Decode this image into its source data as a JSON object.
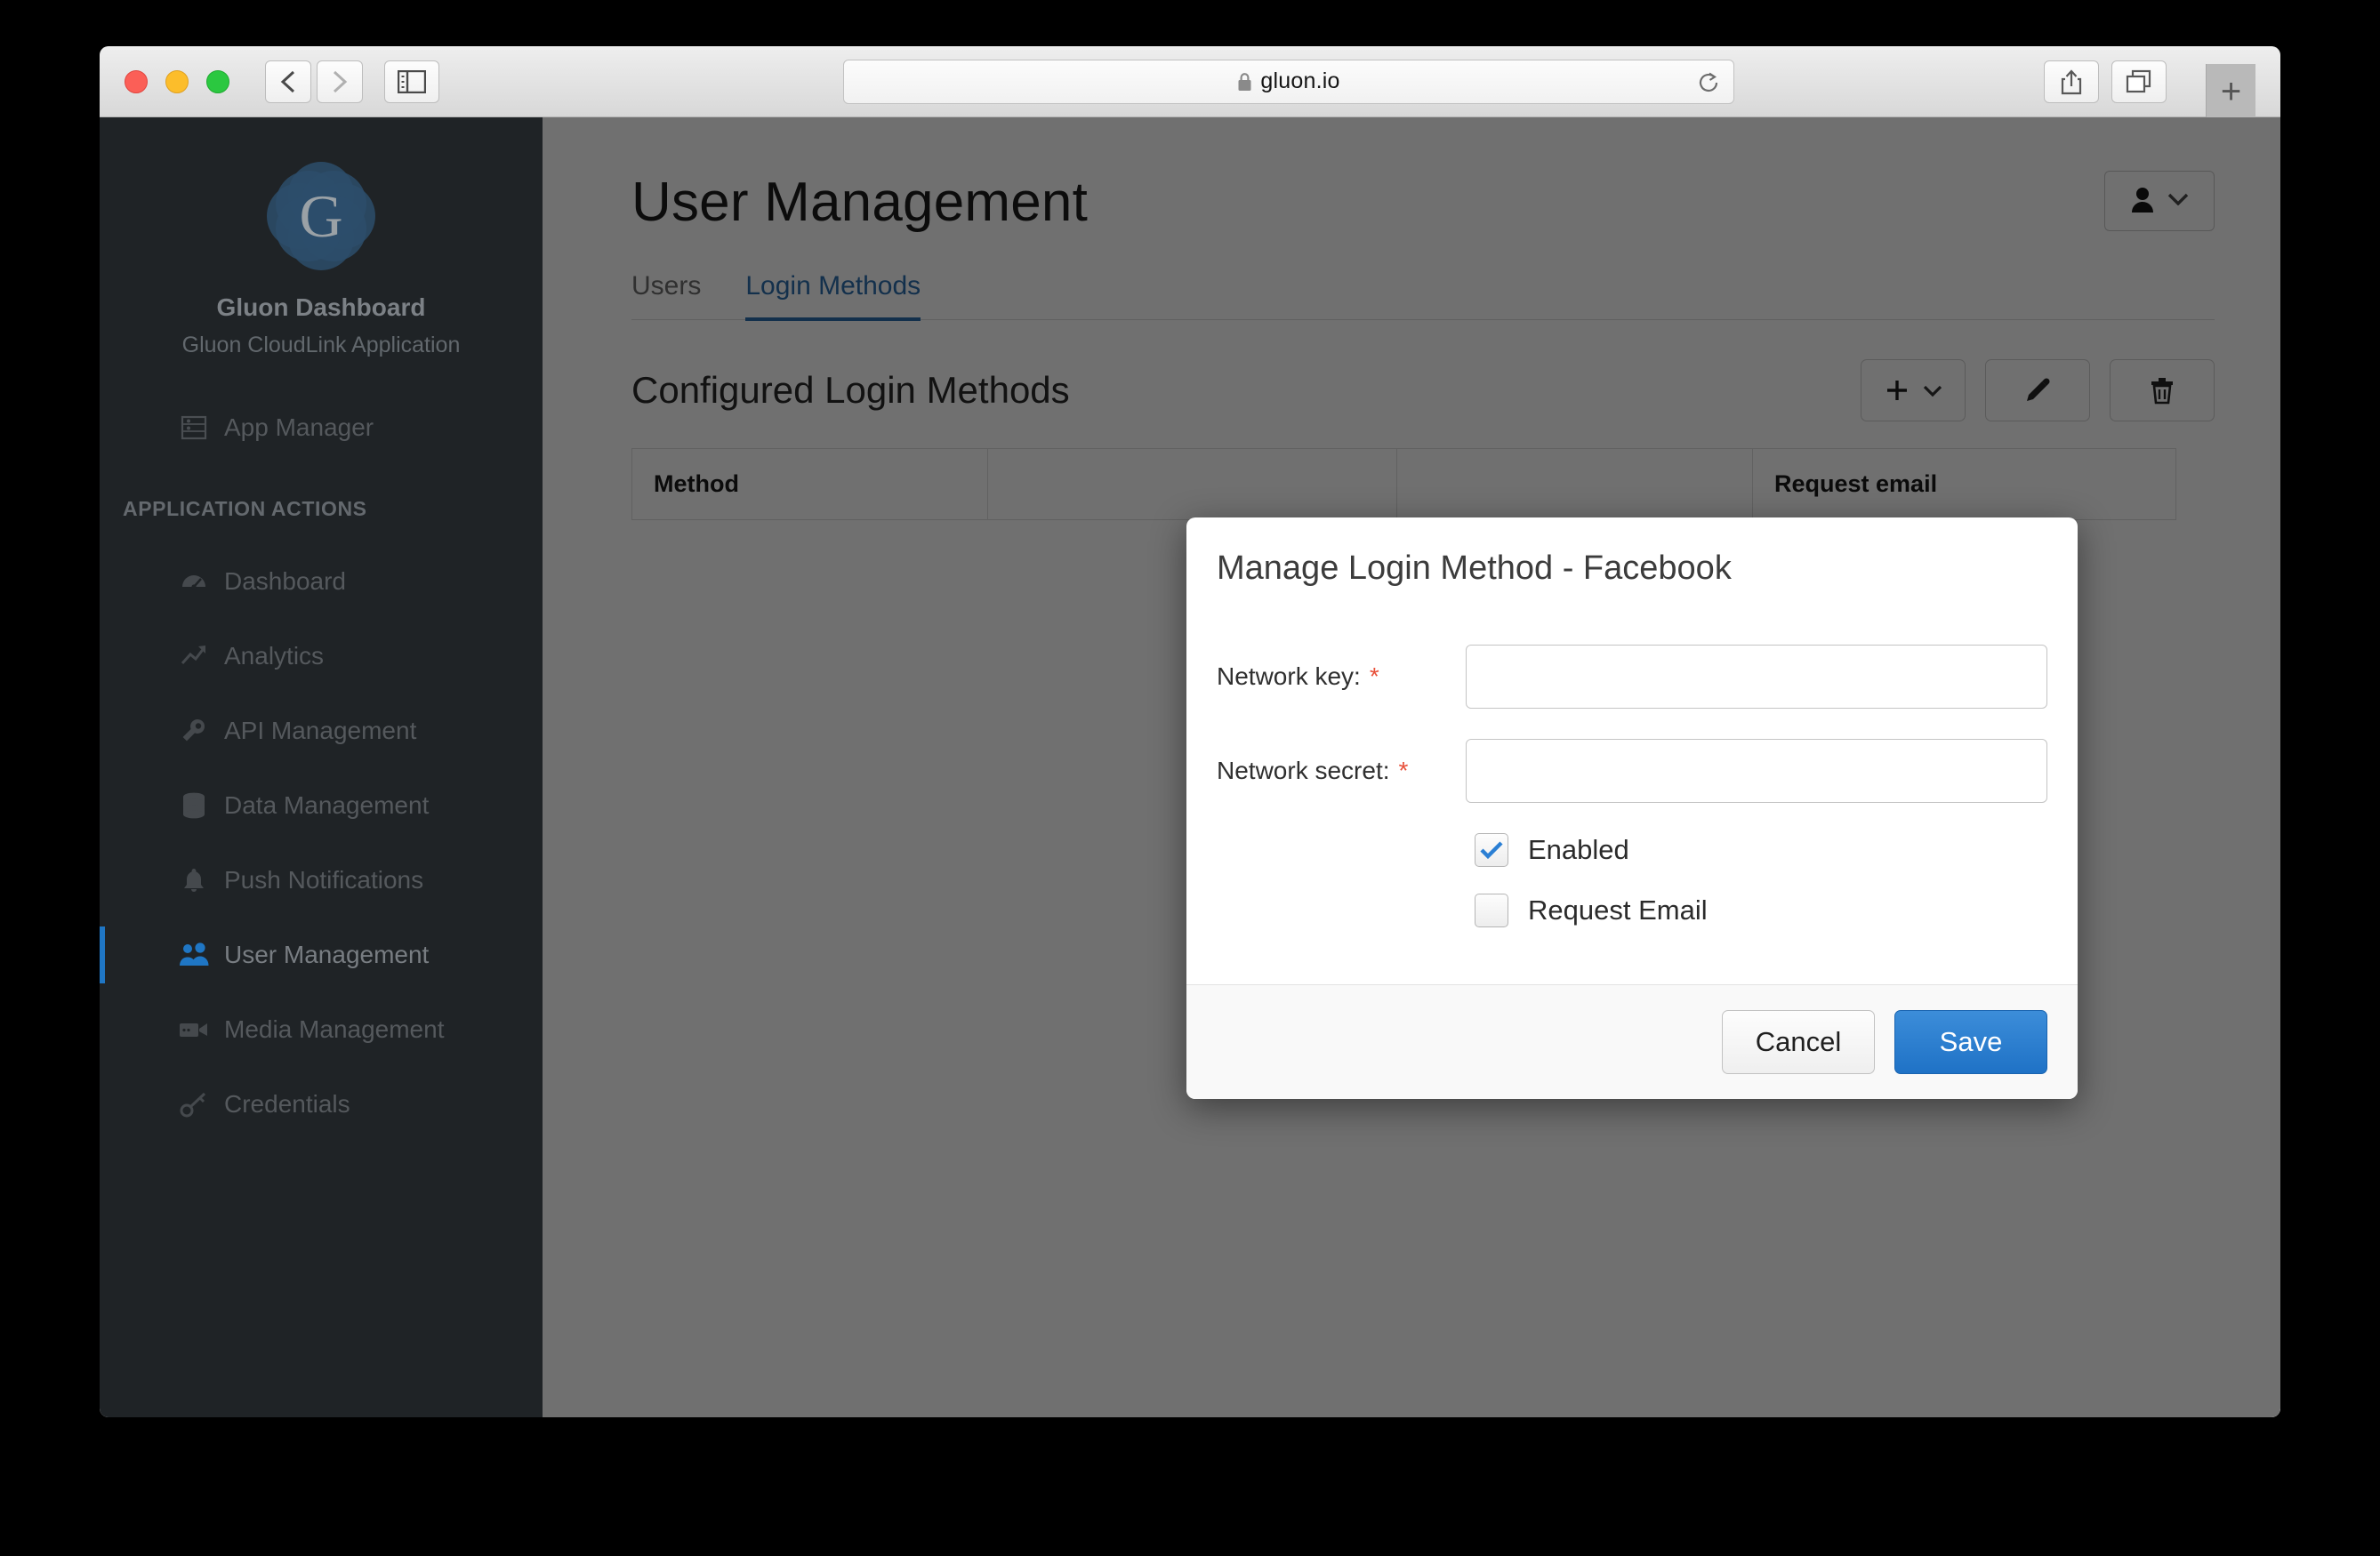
{
  "browser": {
    "url": "gluon.io",
    "lock_icon": "lock-icon",
    "back_icon": "chevron-left-icon",
    "forward_icon": "chevron-right-icon",
    "sidebar_icon": "sidebar-toggle-icon",
    "reload_icon": "reload-icon",
    "share_icon": "share-icon",
    "tabs_icon": "tab-overview-icon",
    "new_tab_label": "+"
  },
  "sidebar": {
    "logo_letter": "G",
    "title": "Gluon Dashboard",
    "subtitle": "Gluon CloudLink Application",
    "top_item": {
      "label": "App Manager",
      "icon": "server-list-icon"
    },
    "section_label": "APPLICATION ACTIONS",
    "items": [
      {
        "label": "Dashboard",
        "icon": "gauge-icon",
        "active": false
      },
      {
        "label": "Analytics",
        "icon": "trend-up-icon",
        "active": false
      },
      {
        "label": "API Management",
        "icon": "wrench-icon",
        "active": false
      },
      {
        "label": "Data Management",
        "icon": "database-icon",
        "active": false
      },
      {
        "label": "Push Notifications",
        "icon": "bell-icon",
        "active": false
      },
      {
        "label": "User Management",
        "icon": "users-icon",
        "active": true
      },
      {
        "label": "Media Management",
        "icon": "video-camera-icon",
        "active": false
      },
      {
        "label": "Credentials",
        "icon": "key-icon",
        "active": false
      }
    ]
  },
  "main": {
    "page_title": "User Management",
    "account_icon": "user-icon",
    "account_chevron_icon": "chevron-down-icon",
    "tabs": [
      {
        "label": "Users",
        "active": false
      },
      {
        "label": "Login Methods",
        "active": true
      }
    ],
    "section_title": "Configured Login Methods",
    "actions": [
      {
        "name": "add-login-method-button",
        "icon": "plus-icon",
        "has_chevron": true
      },
      {
        "name": "edit-login-method-button",
        "icon": "pencil-icon",
        "has_chevron": false
      },
      {
        "name": "delete-login-method-button",
        "icon": "trash-icon",
        "has_chevron": false
      }
    ],
    "table": {
      "columns": [
        "Method",
        "",
        "",
        "Request email"
      ],
      "rows": []
    }
  },
  "modal": {
    "title": "Manage Login Method - Facebook",
    "fields": [
      {
        "label": "Network key:",
        "required": "*",
        "value": "",
        "placeholder": ""
      },
      {
        "label": "Network secret:",
        "required": "*",
        "value": "",
        "placeholder": ""
      }
    ],
    "checkboxes": [
      {
        "label": "Enabled",
        "checked": true
      },
      {
        "label": "Request Email",
        "checked": false
      }
    ],
    "cancel_label": "Cancel",
    "save_label": "Save"
  },
  "colors": {
    "accent_blue": "#1f76c4",
    "save_blue": "#2b7fd4",
    "sidebar_bg": "#1f2326",
    "required_red": "#e8503a"
  }
}
